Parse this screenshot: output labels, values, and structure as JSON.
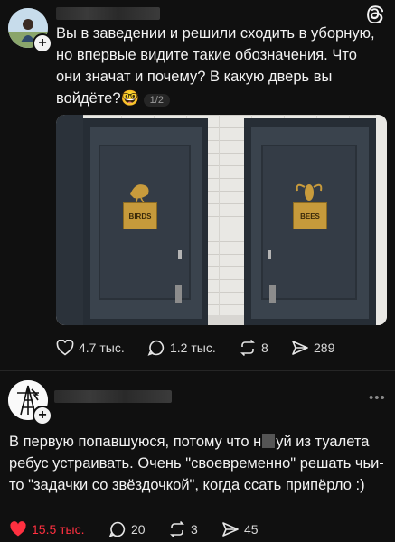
{
  "post": {
    "text": "Вы в заведении и решили сходить в уборную, но впервые видите такие обозначения. Что они значат и почему? В какую дверь вы войдёте?🤓",
    "page_indicator": "1/2",
    "image": {
      "left_sign": "BIRDS",
      "right_sign": "BEES"
    },
    "actions": {
      "likes": "4.7 тыс.",
      "comments": "1.2 тыс.",
      "reposts": "8",
      "shares": "289"
    }
  },
  "reply": {
    "text_part1": "В первую попавшуюся, потому что н",
    "text_part2": "уй из туалета ребус устраивать. Очень \"своевременно\" решать чьи-то \"задачки со звёздочкой\", когда ссать припёрло :)",
    "actions": {
      "likes": "15.5 тыс.",
      "comments": "20",
      "reposts": "3",
      "shares": "45"
    },
    "more_icon": "ellipsis-icon"
  },
  "colors": {
    "background": "#101010",
    "text": "#f3f3f3",
    "liked": "#ff3040"
  }
}
